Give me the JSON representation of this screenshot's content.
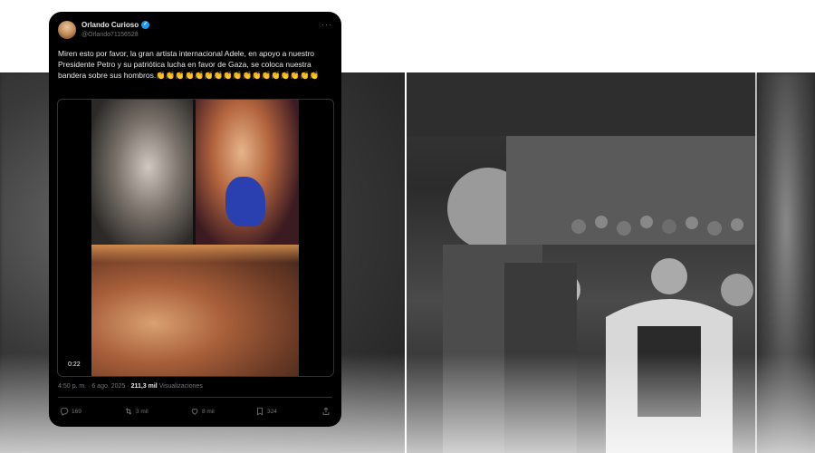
{
  "tweet": {
    "user_name": "Orlando Curioso",
    "user_handle": "@Orlando71156528",
    "text": "Miren esto por favor, la gran artista internacional Adele, en apoyo a nuestro Presidente Petro y su patriótica lucha en favor de Gaza, se coloca nuestra bandera sobre sus hombros.👏👏👏👏👏👏👏👏👏👏👏👏👏👏👏👏👏",
    "video_duration": "0:22",
    "timestamp": "4:50 p. m. · 6 ago. 2025",
    "views_count": "211,3 mil",
    "views_label": "Visualizaciones",
    "actions": {
      "replies": "169",
      "retweets": "3 mil",
      "likes": "8 mil",
      "bookmarks": "324"
    }
  },
  "colors": {
    "card_bg": "#000000",
    "verified": "#1d9bf0",
    "muted_text": "#71767b",
    "primary_text": "#e7e9ea"
  },
  "icons": [
    "verified-badge-icon",
    "more-options-icon",
    "reply-icon",
    "retweet-icon",
    "like-icon",
    "bookmark-icon",
    "share-icon"
  ]
}
